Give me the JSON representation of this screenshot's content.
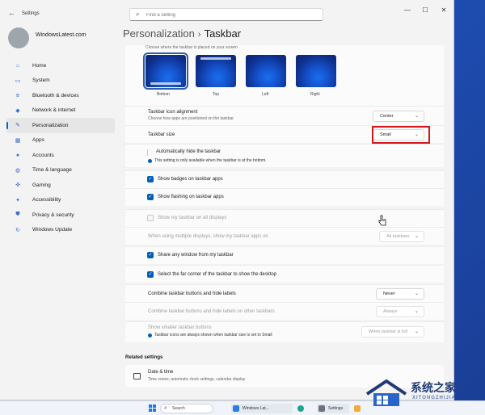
{
  "window": {
    "app_title": "Settings",
    "search_placeholder": "Find a setting",
    "controls": {
      "minimize": "—",
      "maximize": "☐",
      "close": "✕"
    }
  },
  "profile": {
    "name": "WindowsLatest.com"
  },
  "sidebar": {
    "items": [
      {
        "label": "Home",
        "icon": "home-icon",
        "glyph": "⌂"
      },
      {
        "label": "System",
        "icon": "monitor-icon",
        "glyph": "▭"
      },
      {
        "label": "Bluetooth & devices",
        "icon": "bluetooth-icon",
        "glyph": "ʙ"
      },
      {
        "label": "Network & internet",
        "icon": "wifi-icon",
        "glyph": "◆"
      },
      {
        "label": "Personalization",
        "icon": "brush-icon",
        "glyph": "✎",
        "active": true
      },
      {
        "label": "Apps",
        "icon": "apps-icon",
        "glyph": "▦"
      },
      {
        "label": "Accounts",
        "icon": "person-icon",
        "glyph": "●"
      },
      {
        "label": "Time & language",
        "icon": "globe-icon",
        "glyph": "◍"
      },
      {
        "label": "Gaming",
        "icon": "controller-icon",
        "glyph": "✜"
      },
      {
        "label": "Accessibility",
        "icon": "accessibility-icon",
        "glyph": "✦"
      },
      {
        "label": "Privacy & security",
        "icon": "shield-icon",
        "glyph": "⛊"
      },
      {
        "label": "Windows Update",
        "icon": "update-icon",
        "glyph": "↻"
      }
    ]
  },
  "breadcrumb": {
    "parent": "Personalization",
    "separator": "›",
    "current": "Taskbar"
  },
  "taskbar_behaviors": {
    "position_desc": "Choose where the taskbar is placed on your screen",
    "positions": [
      "Bottom",
      "Top",
      "Left",
      "Right"
    ],
    "alignment": {
      "title": "Taskbar icon alignment",
      "desc": "Choose how apps are positioned on the taskbar",
      "value": "Center"
    },
    "size": {
      "title": "Taskbar size",
      "value": "Small"
    },
    "auto_hide": {
      "label": "Automatically hide the taskbar",
      "note": "This setting is only available when the taskbar is at the bottom."
    },
    "show_badges": {
      "label": "Show badges on taskbar apps"
    },
    "show_flashing": {
      "label": "Show flashing on taskbar apps"
    },
    "all_displays": {
      "label": "Show my taskbar on all displays"
    },
    "multi_display": {
      "label": "When using multiple displays, show my taskbar apps on",
      "value": "All taskbars"
    },
    "share_window": {
      "label": "Share any window from my taskbar"
    },
    "far_corner": {
      "label": "Select the far corner of the taskbar to show the desktop"
    },
    "combine": {
      "label": "Combine taskbar buttons and hide labels",
      "value": "Never"
    },
    "combine_other": {
      "label": "Combine taskbar buttons and hide labels on other taskbars",
      "value": "Always"
    },
    "smaller_buttons": {
      "label": "Show smaller taskbar buttons",
      "note": "Taskbar icons are always shown when taskbar size is set to Small",
      "value": "When taskbar is full"
    }
  },
  "related": {
    "title": "Related settings",
    "items": [
      {
        "title": "Date & time",
        "desc": "Time zones, automatic clock settings, calendar display"
      }
    ]
  },
  "os_taskbar": {
    "search_label": "Search",
    "apps": [
      "Windows Lat...",
      "Settings"
    ]
  },
  "watermark": {
    "text": "系统之家",
    "sub": "XITONGZHIJIA"
  },
  "colors": {
    "accent": "#005fb8",
    "highlight": "#d3161c",
    "wallpaper": "#1e4fb6"
  }
}
